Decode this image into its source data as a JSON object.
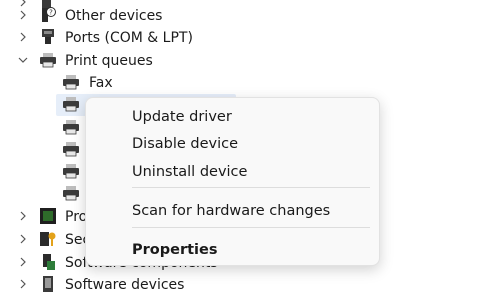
{
  "tree": {
    "items": [
      {
        "label": "",
        "icon": "device-icon"
      },
      {
        "label": "Other devices",
        "icon": "unknown-device-icon"
      },
      {
        "label": "Ports (COM & LPT)",
        "icon": "port-icon"
      },
      {
        "label": "Print queues",
        "icon": "printer-icon"
      },
      {
        "label": "Fax",
        "icon": "printer-icon"
      },
      {
        "label": "",
        "icon": "printer-icon"
      },
      {
        "label": "",
        "icon": "printer-icon"
      },
      {
        "label": "",
        "icon": "printer-icon"
      },
      {
        "label": "",
        "icon": "printer-icon"
      },
      {
        "label": "",
        "icon": "printer-icon"
      },
      {
        "label": "Pro",
        "icon": "processor-icon"
      },
      {
        "label": "Sec",
        "icon": "security-device-icon"
      },
      {
        "label": "Software components",
        "icon": "software-component-icon"
      },
      {
        "label": "Software devices",
        "icon": "software-device-icon"
      }
    ]
  },
  "context_menu": {
    "update_driver": "Update driver",
    "disable_device": "Disable device",
    "uninstall_device": "Uninstall device",
    "scan_hardware": "Scan for hardware changes",
    "properties": "Properties"
  },
  "colors": {
    "selection": "#e6eef9",
    "menu_bg": "#f9f9f9",
    "printer": "#3b3b3b",
    "processor": "#2e6b2a"
  }
}
